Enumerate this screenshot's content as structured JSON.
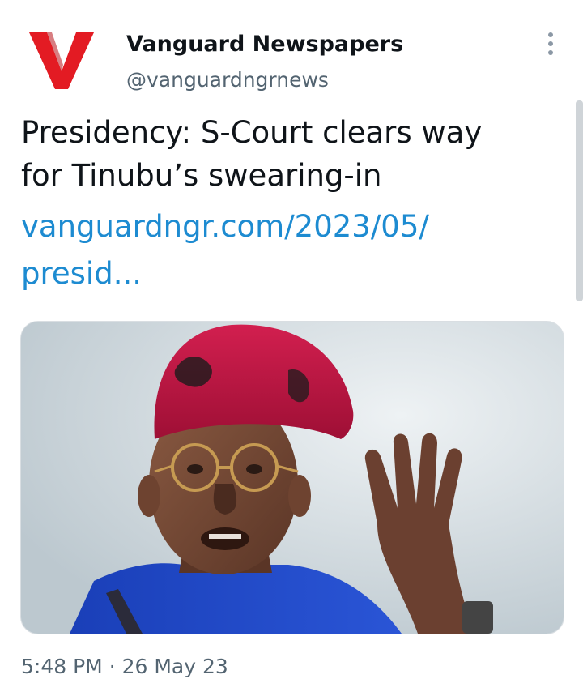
{
  "author": {
    "display_name": "Vanguard Newspapers",
    "handle": "@vanguardngrnews",
    "avatar_letter": "V",
    "brand_color": "#e31b23"
  },
  "tweet": {
    "text_lines": [
      "Presidency: S-Court clears way",
      "for Tinubu’s swearing-in"
    ],
    "link_lines": [
      "vanguardngr.com/2023/05/",
      "presid..."
    ],
    "link_color": "#1d8bd1"
  },
  "media": {
    "icon": "photo-of-man-in-red-cap-with-raised-hand"
  },
  "timestamp": {
    "time": "5:48 PM",
    "separator": "·",
    "date": "26 May 23"
  },
  "icons": {
    "more": "more-vertical-icon"
  }
}
